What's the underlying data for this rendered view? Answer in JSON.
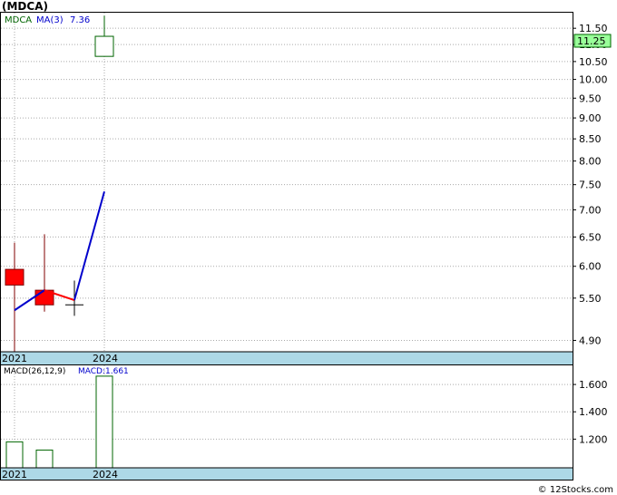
{
  "chart_data": [
    {
      "type": "candlestick",
      "title": "(MDCA)",
      "legend": {
        "symbol": "MDCA",
        "ma_label": "MA(3)",
        "ma_value": "7.36"
      },
      "current_price_label": "11.25",
      "x_tick_labels": [
        "2021",
        "2024"
      ],
      "y_tick_labels": [
        "4.90",
        "5.50",
        "6.00",
        "6.50",
        "7.00",
        "7.50",
        "8.00",
        "8.50",
        "9.00",
        "9.50",
        "10.00",
        "10.50",
        "11.00",
        "11.50"
      ],
      "y_scale": "log",
      "ylim": [
        4.75,
        12.0
      ],
      "candles": [
        {
          "open": 5.7,
          "high": 6.4,
          "low": 4.75,
          "close": 5.95,
          "direction": "down"
        },
        {
          "open": 5.4,
          "high": 6.55,
          "low": 5.3,
          "close": 5.62,
          "direction": "down"
        },
        {
          "open": 5.4,
          "high": 5.77,
          "low": 5.24,
          "close": 5.4,
          "direction": "flat"
        },
        {
          "open": 10.65,
          "high": 11.9,
          "low": 10.65,
          "close": 11.25,
          "direction": "up"
        }
      ],
      "ma_line": [
        5.32,
        5.62,
        5.47,
        7.36
      ],
      "colors": {
        "up": "#006400",
        "down": "#ff0000",
        "ma_up": "#0000cc",
        "ma_down": "#ff0000",
        "price_box": "#99ff99",
        "axis_band": "#add8e6"
      }
    },
    {
      "type": "bar",
      "title": "MACD(26,12,9)",
      "value_label": "MACD:1.661",
      "x_tick_labels": [
        "2021",
        "2024"
      ],
      "y_tick_labels": [
        "1.200",
        "1.400",
        "1.600"
      ],
      "ylim": [
        0.99,
        1.74
      ],
      "values": [
        1.18,
        1.12,
        null,
        1.661
      ]
    }
  ],
  "footer": {
    "credit": "© 12Stocks.com"
  }
}
